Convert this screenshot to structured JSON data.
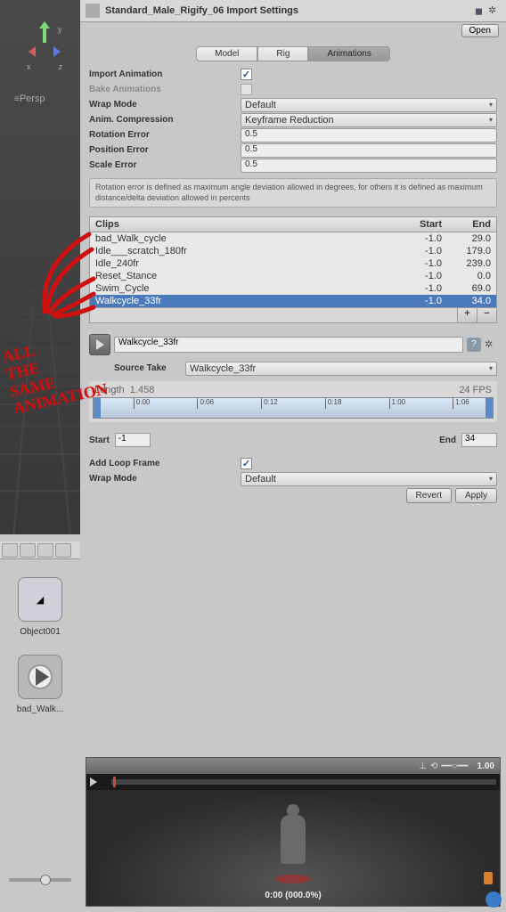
{
  "inspector": {
    "title": "Standard_Male_Rigify_06 Import Settings",
    "open_btn": "Open"
  },
  "tabs": [
    "Model",
    "Rig",
    "Animations"
  ],
  "props": {
    "import_animation": "Import Animation",
    "bake_animations": "Bake Animations",
    "wrap_mode": "Wrap Mode",
    "wrap_mode_val": "Default",
    "anim_compression": "Anim. Compression",
    "anim_compression_val": "Keyframe Reduction",
    "rotation_error": "Rotation Error",
    "rotation_error_val": "0.5",
    "position_error": "Position Error",
    "position_error_val": "0.5",
    "scale_error": "Scale Error",
    "scale_error_val": "0.5",
    "info": "Rotation error is defined as maximum angle deviation allowed in degrees, for others it is defined as maximum distance/delta deviation allowed in percents"
  },
  "clips": {
    "header_name": "Clips",
    "header_start": "Start",
    "header_end": "End",
    "rows": [
      {
        "name": "bad_Walk_cycle",
        "start": "-1.0",
        "end": "29.0"
      },
      {
        "name": "Idle___scratch_180fr",
        "start": "-1.0",
        "end": "179.0"
      },
      {
        "name": "Idle_240fr",
        "start": "-1.0",
        "end": "239.0"
      },
      {
        "name": "Reset_Stance",
        "start": "-1.0",
        "end": "0.0"
      },
      {
        "name": "Swim_Cycle",
        "start": "-1.0",
        "end": "69.0"
      },
      {
        "name": "Walkcycle_33fr",
        "start": "-1.0",
        "end": "34.0"
      }
    ]
  },
  "clip_detail": {
    "name": "Walkcycle_33fr",
    "source_take_label": "Source Take",
    "source_take_val": "Walkcycle_33fr",
    "length_label": "Length",
    "length_val": "1.458",
    "fps": "24 FPS",
    "ticks": [
      "0:00",
      "0:06",
      "0:12",
      "0:18",
      "1:00",
      "1:06"
    ],
    "start_label": "Start",
    "start_val": "-1",
    "end_label": "End",
    "end_val": "34",
    "add_loop": "Add Loop Frame",
    "wrap_mode": "Wrap Mode",
    "wrap_mode_val": "Default"
  },
  "buttons": {
    "revert": "Revert",
    "apply": "Apply"
  },
  "preview": {
    "speed": "1.00",
    "time": "0:00 (000.0%)"
  },
  "viewport": {
    "persp": "Persp",
    "axis_x": "x",
    "axis_y": "y",
    "axis_z": "z"
  },
  "assets": {
    "obj": "Object001",
    "anim": "bad_Walk..."
  },
  "annotation": "ALL\nTHE\nSAME\nANIMATION"
}
